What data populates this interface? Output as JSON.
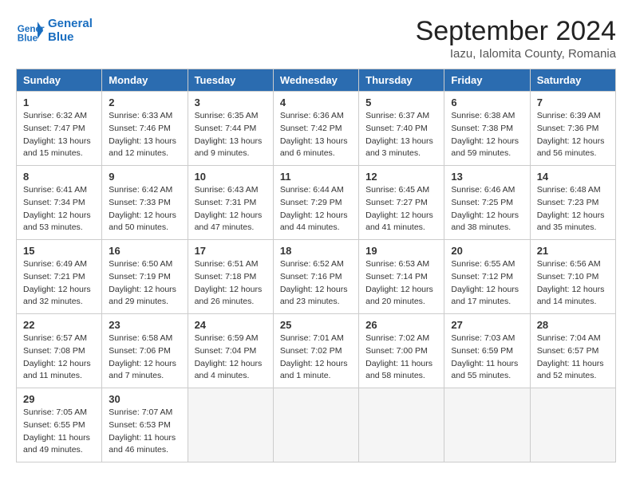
{
  "header": {
    "logo_line1": "General",
    "logo_line2": "Blue",
    "month": "September 2024",
    "location": "Iazu, Ialomita County, Romania"
  },
  "days_of_week": [
    "Sunday",
    "Monday",
    "Tuesday",
    "Wednesday",
    "Thursday",
    "Friday",
    "Saturday"
  ],
  "weeks": [
    [
      {
        "num": "1",
        "sunrise": "Sunrise: 6:32 AM",
        "sunset": "Sunset: 7:47 PM",
        "daylight": "Daylight: 13 hours and 15 minutes."
      },
      {
        "num": "2",
        "sunrise": "Sunrise: 6:33 AM",
        "sunset": "Sunset: 7:46 PM",
        "daylight": "Daylight: 13 hours and 12 minutes."
      },
      {
        "num": "3",
        "sunrise": "Sunrise: 6:35 AM",
        "sunset": "Sunset: 7:44 PM",
        "daylight": "Daylight: 13 hours and 9 minutes."
      },
      {
        "num": "4",
        "sunrise": "Sunrise: 6:36 AM",
        "sunset": "Sunset: 7:42 PM",
        "daylight": "Daylight: 13 hours and 6 minutes."
      },
      {
        "num": "5",
        "sunrise": "Sunrise: 6:37 AM",
        "sunset": "Sunset: 7:40 PM",
        "daylight": "Daylight: 13 hours and 3 minutes."
      },
      {
        "num": "6",
        "sunrise": "Sunrise: 6:38 AM",
        "sunset": "Sunset: 7:38 PM",
        "daylight": "Daylight: 12 hours and 59 minutes."
      },
      {
        "num": "7",
        "sunrise": "Sunrise: 6:39 AM",
        "sunset": "Sunset: 7:36 PM",
        "daylight": "Daylight: 12 hours and 56 minutes."
      }
    ],
    [
      {
        "num": "8",
        "sunrise": "Sunrise: 6:41 AM",
        "sunset": "Sunset: 7:34 PM",
        "daylight": "Daylight: 12 hours and 53 minutes."
      },
      {
        "num": "9",
        "sunrise": "Sunrise: 6:42 AM",
        "sunset": "Sunset: 7:33 PM",
        "daylight": "Daylight: 12 hours and 50 minutes."
      },
      {
        "num": "10",
        "sunrise": "Sunrise: 6:43 AM",
        "sunset": "Sunset: 7:31 PM",
        "daylight": "Daylight: 12 hours and 47 minutes."
      },
      {
        "num": "11",
        "sunrise": "Sunrise: 6:44 AM",
        "sunset": "Sunset: 7:29 PM",
        "daylight": "Daylight: 12 hours and 44 minutes."
      },
      {
        "num": "12",
        "sunrise": "Sunrise: 6:45 AM",
        "sunset": "Sunset: 7:27 PM",
        "daylight": "Daylight: 12 hours and 41 minutes."
      },
      {
        "num": "13",
        "sunrise": "Sunrise: 6:46 AM",
        "sunset": "Sunset: 7:25 PM",
        "daylight": "Daylight: 12 hours and 38 minutes."
      },
      {
        "num": "14",
        "sunrise": "Sunrise: 6:48 AM",
        "sunset": "Sunset: 7:23 PM",
        "daylight": "Daylight: 12 hours and 35 minutes."
      }
    ],
    [
      {
        "num": "15",
        "sunrise": "Sunrise: 6:49 AM",
        "sunset": "Sunset: 7:21 PM",
        "daylight": "Daylight: 12 hours and 32 minutes."
      },
      {
        "num": "16",
        "sunrise": "Sunrise: 6:50 AM",
        "sunset": "Sunset: 7:19 PM",
        "daylight": "Daylight: 12 hours and 29 minutes."
      },
      {
        "num": "17",
        "sunrise": "Sunrise: 6:51 AM",
        "sunset": "Sunset: 7:18 PM",
        "daylight": "Daylight: 12 hours and 26 minutes."
      },
      {
        "num": "18",
        "sunrise": "Sunrise: 6:52 AM",
        "sunset": "Sunset: 7:16 PM",
        "daylight": "Daylight: 12 hours and 23 minutes."
      },
      {
        "num": "19",
        "sunrise": "Sunrise: 6:53 AM",
        "sunset": "Sunset: 7:14 PM",
        "daylight": "Daylight: 12 hours and 20 minutes."
      },
      {
        "num": "20",
        "sunrise": "Sunrise: 6:55 AM",
        "sunset": "Sunset: 7:12 PM",
        "daylight": "Daylight: 12 hours and 17 minutes."
      },
      {
        "num": "21",
        "sunrise": "Sunrise: 6:56 AM",
        "sunset": "Sunset: 7:10 PM",
        "daylight": "Daylight: 12 hours and 14 minutes."
      }
    ],
    [
      {
        "num": "22",
        "sunrise": "Sunrise: 6:57 AM",
        "sunset": "Sunset: 7:08 PM",
        "daylight": "Daylight: 12 hours and 11 minutes."
      },
      {
        "num": "23",
        "sunrise": "Sunrise: 6:58 AM",
        "sunset": "Sunset: 7:06 PM",
        "daylight": "Daylight: 12 hours and 7 minutes."
      },
      {
        "num": "24",
        "sunrise": "Sunrise: 6:59 AM",
        "sunset": "Sunset: 7:04 PM",
        "daylight": "Daylight: 12 hours and 4 minutes."
      },
      {
        "num": "25",
        "sunrise": "Sunrise: 7:01 AM",
        "sunset": "Sunset: 7:02 PM",
        "daylight": "Daylight: 12 hours and 1 minute."
      },
      {
        "num": "26",
        "sunrise": "Sunrise: 7:02 AM",
        "sunset": "Sunset: 7:00 PM",
        "daylight": "Daylight: 11 hours and 58 minutes."
      },
      {
        "num": "27",
        "sunrise": "Sunrise: 7:03 AM",
        "sunset": "Sunset: 6:59 PM",
        "daylight": "Daylight: 11 hours and 55 minutes."
      },
      {
        "num": "28",
        "sunrise": "Sunrise: 7:04 AM",
        "sunset": "Sunset: 6:57 PM",
        "daylight": "Daylight: 11 hours and 52 minutes."
      }
    ],
    [
      {
        "num": "29",
        "sunrise": "Sunrise: 7:05 AM",
        "sunset": "Sunset: 6:55 PM",
        "daylight": "Daylight: 11 hours and 49 minutes."
      },
      {
        "num": "30",
        "sunrise": "Sunrise: 7:07 AM",
        "sunset": "Sunset: 6:53 PM",
        "daylight": "Daylight: 11 hours and 46 minutes."
      },
      null,
      null,
      null,
      null,
      null
    ]
  ]
}
